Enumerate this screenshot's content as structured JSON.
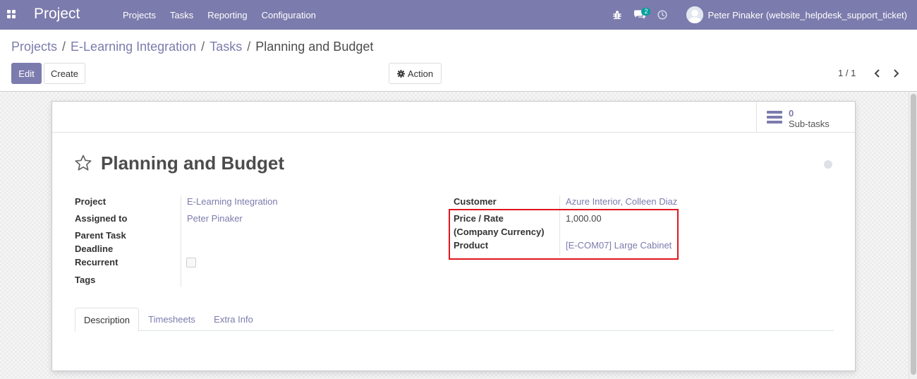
{
  "navbar": {
    "app_title": "Project",
    "menu": [
      "Projects",
      "Tasks",
      "Reporting",
      "Configuration"
    ],
    "messages_badge": "2",
    "user_name": "Peter Pinaker (website_helpdesk_support_ticket)",
    "bg_color": "#7c7bad"
  },
  "breadcrumb": {
    "items": [
      "Projects",
      "E-Learning Integration",
      "Tasks"
    ],
    "separator": "/",
    "current": "Planning and Budget"
  },
  "buttons": {
    "edit": "Edit",
    "create": "Create",
    "action": "Action"
  },
  "pager": {
    "value": "1 / 1"
  },
  "sheet": {
    "subtasks_count": "0",
    "subtasks_label": "Sub-tasks",
    "title": "Planning and Budget",
    "left_fields": {
      "project_label": "Project",
      "project_value": "E-Learning Integration",
      "assigned_label": "Assigned to",
      "assigned_value": "Peter Pinaker",
      "parent_label": "Parent Task",
      "deadline_label": "Deadline",
      "recurrent_label": "Recurrent",
      "tags_label": "Tags"
    },
    "right_fields": {
      "customer_label": "Customer",
      "customer_value": "Azure Interior, Colleen Diaz",
      "price_label_line1": "Price / Rate",
      "price_label_line2": "(Company Currency)",
      "price_value": "1,000.00",
      "product_label": "Product",
      "product_value": "[E-COM07] Large Cabinet"
    },
    "tabs": [
      "Description",
      "Timesheets",
      "Extra Info"
    ],
    "highlight_color": "#e0161b"
  }
}
